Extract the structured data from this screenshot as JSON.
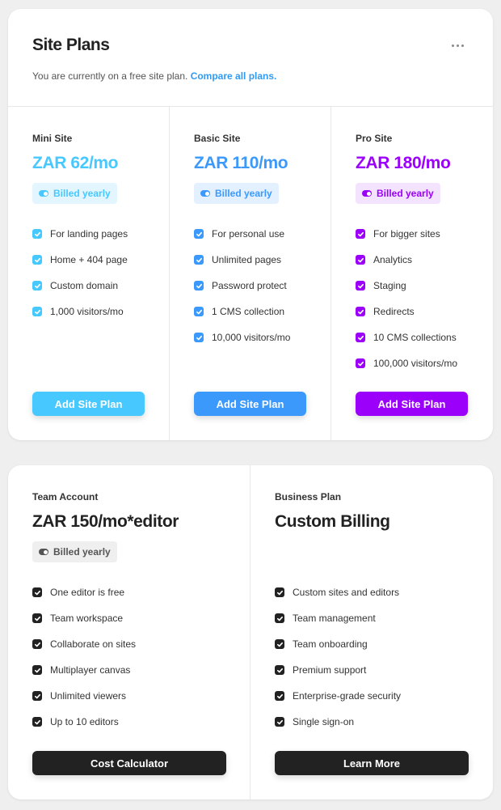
{
  "site_plans": {
    "title": "Site Plans",
    "subtitle_text": "You are currently on a free site plan. ",
    "compare_link": "Compare all plans.",
    "more_icon": "more-horizontal-icon",
    "plans": [
      {
        "name": "Mini Site",
        "price": "ZAR 62/mo",
        "billing": "Billed yearly",
        "color": "#47c8ff",
        "badge_bg": "#e3f6ff",
        "features": [
          "For landing pages",
          "Home + 404 page",
          "Custom domain",
          "1,000 visitors/mo"
        ],
        "button": "Add Site Plan"
      },
      {
        "name": "Basic Site",
        "price": "ZAR 110/mo",
        "billing": "Billed yearly",
        "color": "#3b99fc",
        "badge_bg": "#e3f0ff",
        "features": [
          "For personal use",
          "Unlimited pages",
          "Password protect",
          "1 CMS collection",
          "10,000 visitors/mo"
        ],
        "button": "Add Site Plan"
      },
      {
        "name": "Pro Site",
        "price": "ZAR 180/mo",
        "billing": "Billed yearly",
        "color": "#9b00fa",
        "badge_bg": "#f3e3fe",
        "features": [
          "For bigger sites",
          "Analytics",
          "Staging",
          "Redirects",
          "10 CMS collections",
          "100,000 visitors/mo"
        ],
        "button": "Add Site Plan"
      }
    ]
  },
  "team_plans": [
    {
      "name": "Team Account",
      "price": "ZAR 150/mo*editor",
      "billing": "Billed yearly",
      "color": "#222222",
      "badge_bg": "#efefef",
      "features": [
        "One editor is free",
        "Team workspace",
        "Collaborate on sites",
        "Multiplayer canvas",
        "Unlimited viewers",
        "Up to 10 editors"
      ],
      "button": "Cost Calculator"
    },
    {
      "name": "Business Plan",
      "price": "Custom Billing",
      "color": "#222222",
      "features": [
        "Custom sites and editors",
        "Team management",
        "Team onboarding",
        "Premium support",
        "Enterprise-grade security",
        "Single sign-on"
      ],
      "button": "Learn More"
    }
  ]
}
